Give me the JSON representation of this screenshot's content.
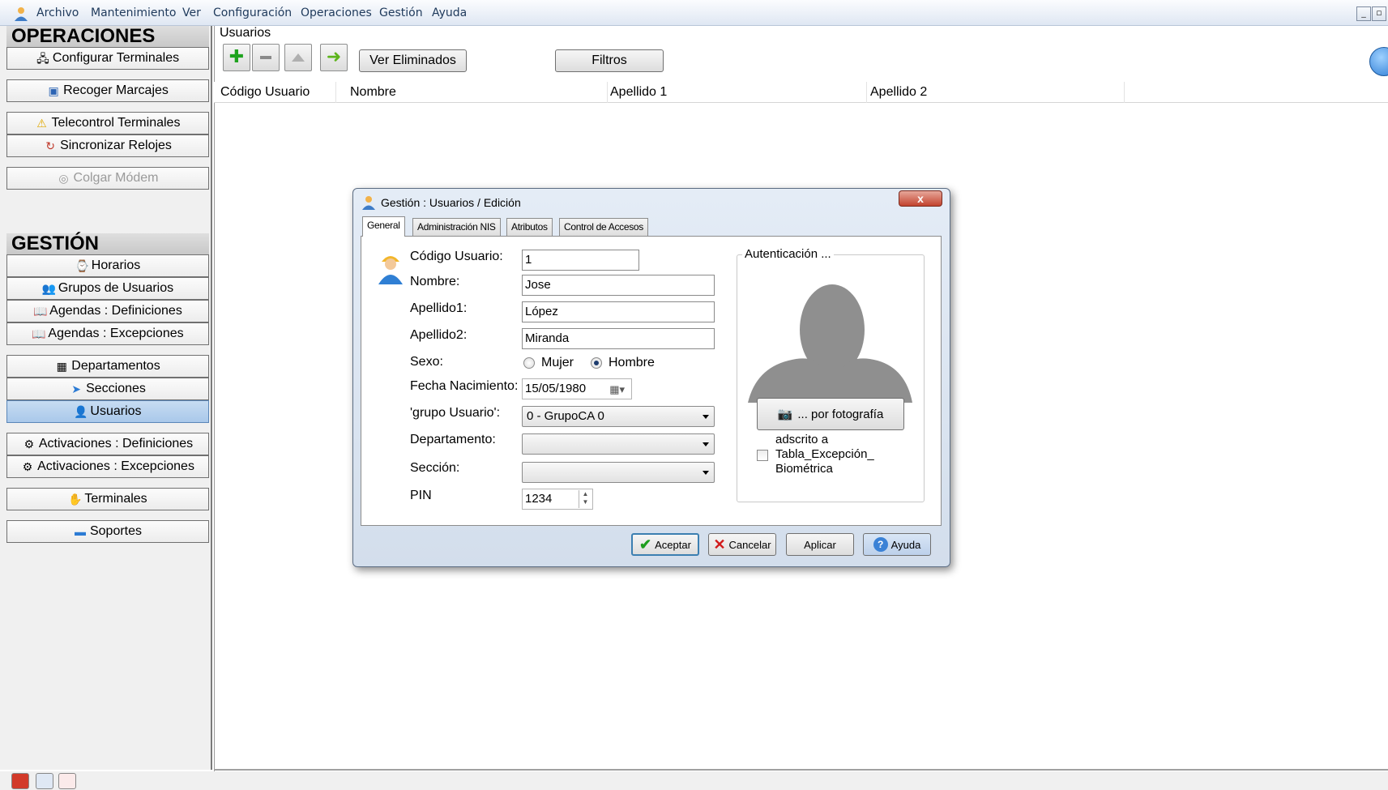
{
  "menubar": {
    "items": [
      "Archivo",
      "Mantenimiento",
      "Ver",
      "Configuración",
      "Operaciones",
      "Gestión",
      "Ayuda"
    ]
  },
  "sidebar": {
    "operaciones_title": "OPERACIONES",
    "gestion_title": "GESTIÓN",
    "items": [
      {
        "label": "Configurar Terminales",
        "icon": "terminal-config-icon"
      },
      {
        "label": "Recoger Marcajes",
        "icon": "collect-icon"
      },
      {
        "label": "Telecontrol Terminales",
        "icon": "warning-icon"
      },
      {
        "label": "Sincronizar Relojes",
        "icon": "sync-clock-icon"
      },
      {
        "label": "Colgar Módem",
        "icon": "modem-icon",
        "disabled": true
      },
      {
        "label": "Horarios",
        "icon": "schedule-icon"
      },
      {
        "label": "Grupos de Usuarios",
        "icon": "user-groups-icon"
      },
      {
        "label": "Agendas : Definiciones",
        "icon": "agenda-icon"
      },
      {
        "label": "Agendas : Excepciones",
        "icon": "agenda-icon"
      },
      {
        "label": "Departamentos",
        "icon": "departments-icon"
      },
      {
        "label": "Secciones",
        "icon": "sections-icon"
      },
      {
        "label": "Usuarios",
        "icon": "user-icon",
        "active": true
      },
      {
        "label": "Activaciones : Definiciones",
        "icon": "activation-icon"
      },
      {
        "label": "Activaciones : Excepciones",
        "icon": "activation-icon"
      },
      {
        "label": "Terminales",
        "icon": "terminals-icon"
      },
      {
        "label": "Soportes",
        "icon": "media-icon"
      }
    ]
  },
  "main": {
    "title": "Usuarios",
    "buttons": {
      "ver_eliminados": "Ver Eliminados",
      "filtros": "Filtros"
    },
    "columns": [
      "Código Usuario",
      "Nombre",
      "Apellido 1",
      "Apellido 2"
    ]
  },
  "dialog": {
    "title": "Gestión : Usuarios / Edición",
    "close": "x",
    "tabs": [
      "General",
      "Administración NIS",
      "Atributos",
      "Control de Accesos"
    ],
    "labels": {
      "codigo": "Código Usuario:",
      "nombre": "Nombre:",
      "apellido1": "Apellido1:",
      "apellido2": "Apellido2:",
      "sexo": "Sexo:",
      "fecha": "Fecha Nacimiento:",
      "grupo": "'grupo Usuario':",
      "departamento": "Departamento:",
      "seccion": "Sección:",
      "pin": "PIN"
    },
    "values": {
      "codigo": "1",
      "nombre": "Jose",
      "apellido1": "López",
      "apellido2": "Miranda",
      "fecha": "15/05/1980",
      "grupo": "0 - GrupoCA 0",
      "departamento": "",
      "seccion": "",
      "pin": "1234"
    },
    "sexo_options": {
      "mujer": "Mujer",
      "hombre": "Hombre",
      "selected": "Hombre"
    },
    "auth": {
      "title": "Autenticación ...",
      "photo_button": "... por fotografía",
      "checkbox_label_1": "adscrito a",
      "checkbox_label_2": "Tabla_Excepción_",
      "checkbox_label_3": "Biométrica",
      "checked": false
    },
    "footer": {
      "aceptar": "Aceptar",
      "cancelar": "Cancelar",
      "aplicar": "Aplicar",
      "ayuda": "Ayuda"
    }
  },
  "colors": {
    "active_item": "#b7d1ee",
    "dialog_bg": "#dbe5f1",
    "close_button": "#c9513c"
  }
}
